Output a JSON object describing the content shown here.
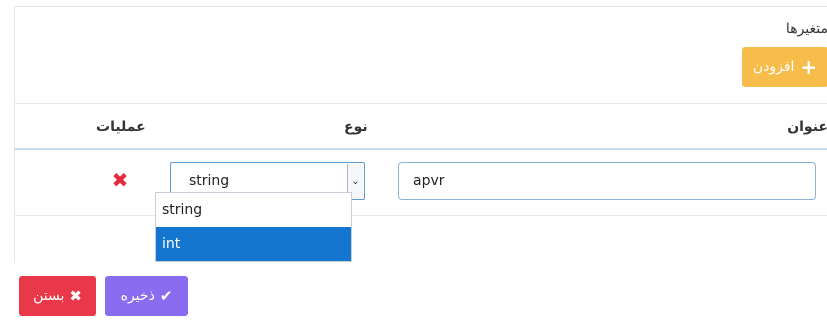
{
  "variables": {
    "section_title": "متغیرها",
    "add_button": {
      "icon": "plus-icon",
      "label": "افزودن",
      "color": "#f6bd4a"
    },
    "table": {
      "columns": {
        "title": "عنوان",
        "type": "نوع",
        "operations": "عملیات"
      },
      "rows": [
        {
          "title_value": "apvr",
          "type_value": "string",
          "remove_icon": "close-icon"
        }
      ]
    },
    "type_dropdown": {
      "options": [
        "string",
        "int"
      ],
      "highlighted": "int",
      "highlight_color": "#1576d0"
    }
  },
  "footer": {
    "close_button": {
      "icon": "close-icon",
      "label": "بستن",
      "color": "#e8384a"
    },
    "save_button": {
      "icon": "check-icon",
      "label": "ذخیره",
      "color": "#8a6cf0"
    }
  }
}
